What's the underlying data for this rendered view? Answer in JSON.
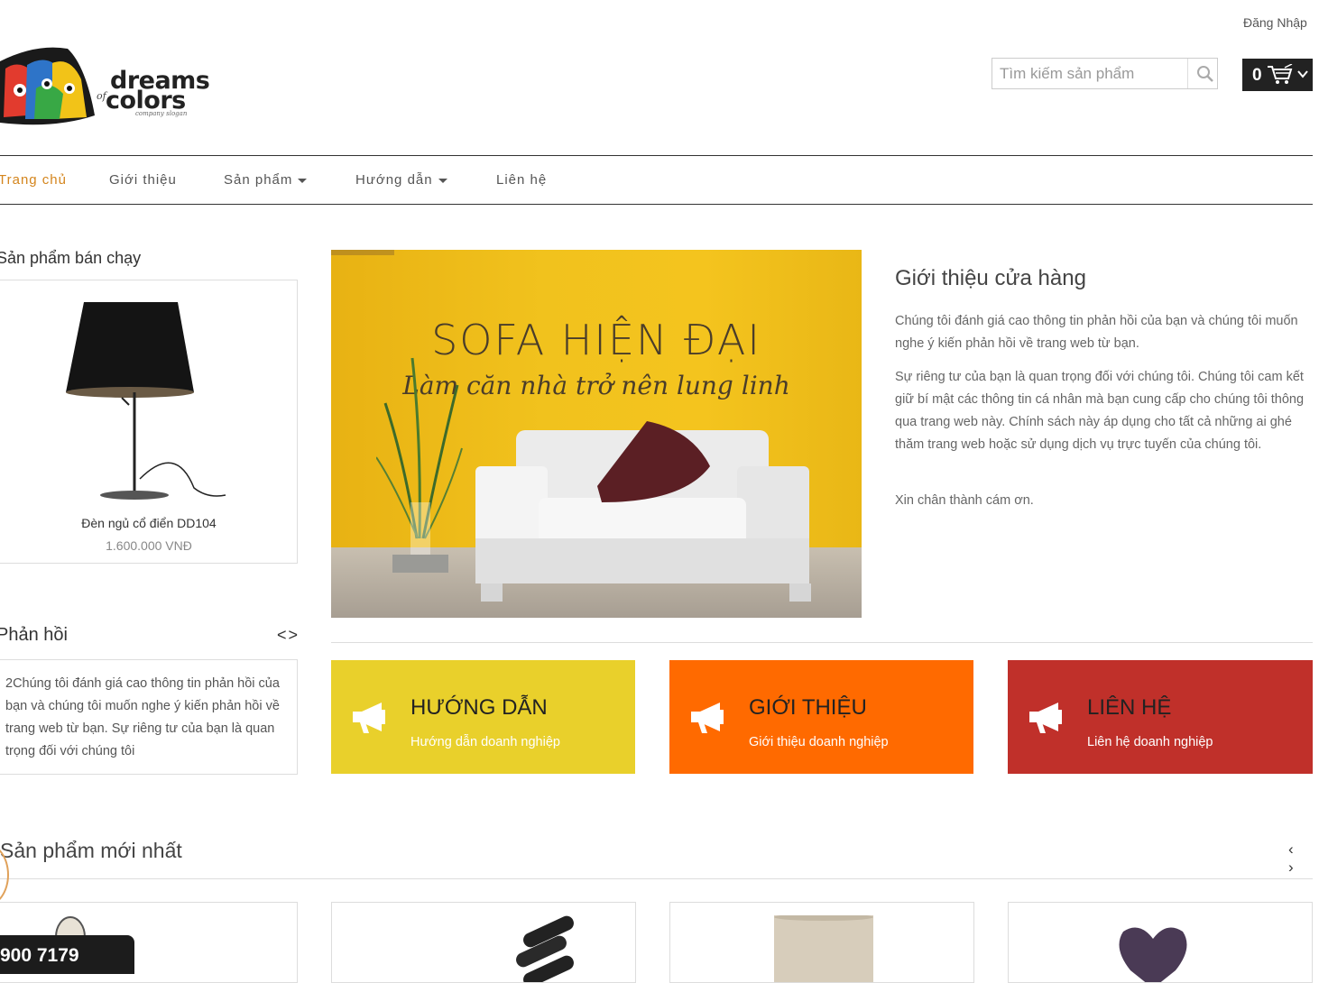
{
  "header": {
    "login": "Đăng Nhập",
    "logo": {
      "line1": "dreams",
      "line2": "colors",
      "of": "of",
      "slogan": "company slogan"
    },
    "search_placeholder": "Tìm kiếm sản phẩm",
    "cart_count": "0"
  },
  "nav": [
    {
      "label": "Trang chủ",
      "active": true
    },
    {
      "label": "Giới thiệu"
    },
    {
      "label": "Sản phẩm",
      "dropdown": true
    },
    {
      "label": "Hướng dẫn",
      "dropdown": true
    },
    {
      "label": "Liên hệ"
    }
  ],
  "bestseller": {
    "title": "Sản phẩm bán chạy",
    "product": {
      "name": "Đèn ngủ cổ điển DD104",
      "price": "1.600.000 VNĐ"
    }
  },
  "feedback": {
    "title": "Phản hồi",
    "nav": "<>",
    "text": "2Chúng tôi đánh giá cao thông tin phản hồi của bạn và chúng tôi muốn nghe ý kiến phản hồi về trang web từ bạn. Sự riêng tư của bạn là quan trọng đối với chúng tôi"
  },
  "banner": {
    "headline": "SOFA HIỆN ĐẠI",
    "tagline": "Làm căn nhà trở nên lung linh"
  },
  "intro": {
    "title": "Giới thiệu cửa hàng",
    "p1": "Chúng tôi đánh giá cao thông tin phản hồi của bạn và chúng tôi muốn nghe ý kiến phản hồi về trang web từ bạn.",
    "p2": "Sự riêng tư của bạn là quan trọng đối với chúng tôi. Chúng tôi cam kết giữ bí mật các thông tin cá nhân mà bạn cung cấp cho chúng tôi thông qua trang web này. Chính sách này áp dụng cho tất cả những ai ghé thăm trang web hoặc sử dụng dịch vụ trực tuyến của chúng tôi.",
    "p3": "Xin chân thành cám ơn."
  },
  "promos": [
    {
      "title": "HƯỚNG DẪN",
      "subtitle": "Hướng dẫn doanh nghiệp",
      "color": "#e9d02b"
    },
    {
      "title": "GIỚI THIỆU",
      "subtitle": "Giới thiệu doanh nghiệp",
      "color": "#ff6a00"
    },
    {
      "title": "LIÊN HỆ",
      "subtitle": "Liên hệ doanh nghiệp",
      "color": "#c0302a"
    }
  ],
  "new_products": {
    "title": "Sản phẩm mới nhất",
    "nav": "‹ ›"
  },
  "hotline": "900 7179",
  "colors": {
    "accent": "#d4851d",
    "dark": "#222222"
  }
}
